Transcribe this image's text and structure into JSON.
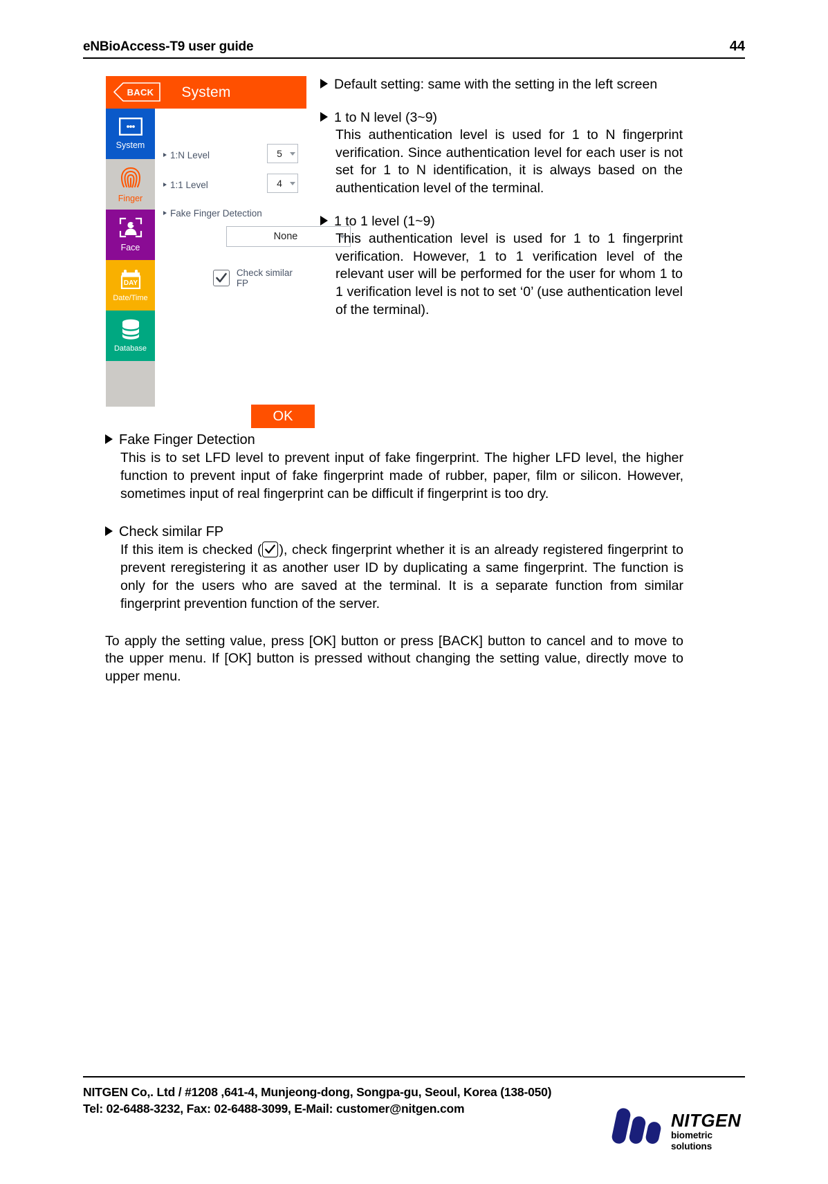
{
  "header": {
    "title": "eNBioAccess-T9 user guide",
    "page_number": "44"
  },
  "device": {
    "back_label": "BACK",
    "screen_title": "System",
    "sidebar": [
      {
        "label": "System",
        "icon": "system-window-icon",
        "color": "#0a59c9"
      },
      {
        "label": "Finger",
        "icon": "fingerprint-icon",
        "color": "#cccac6"
      },
      {
        "label": "Face",
        "icon": "face-enroll-icon",
        "color": "#8a0b94"
      },
      {
        "label": "Date/Time",
        "icon": "calendar-day-icon",
        "color": "#f9b000"
      },
      {
        "label": "Database",
        "icon": "database-stack-icon",
        "color": "#00a881"
      }
    ],
    "rows": [
      {
        "label": "1:N Level",
        "value": "5"
      },
      {
        "label": "1:1 Level",
        "value": "4"
      }
    ],
    "fake_finger": {
      "label": "Fake Finger Detection",
      "value": "None"
    },
    "check_similar": {
      "label": "Check similar FP",
      "checked": true
    },
    "ok_label": "OK"
  },
  "right_column": {
    "default_setting": "Default setting: same with the setting in the left screen",
    "sections": [
      {
        "heading": "1 to N level (3~9)",
        "body": "This authentication level is used for 1 to N fingerprint verification. Since authentication level for each user is not set for 1 to N identification, it is always based on the authentication level of the terminal."
      },
      {
        "heading": "1 to 1 level (1~9)",
        "body": "This authentication level is used for 1 to 1 fingerprint verification. However, 1 to 1 verification level of the relevant user will be performed for the user for whom 1 to 1 verification level is not to set ‘0’ (use authentication level of the terminal)."
      }
    ]
  },
  "lower_sections": [
    {
      "heading": "Fake Finger Detection",
      "body": "This is to set LFD level to prevent input of fake fingerprint. The higher LFD level, the higher function to prevent input of fake fingerprint made of rubber, paper, film or silicon. However, sometimes input of real fingerprint can be difficult if fingerprint is too dry."
    }
  ],
  "check_similar_section": {
    "heading": "Check similar FP",
    "body_before": "If this item is checked (",
    "body_after": "), check fingerprint whether it is an already registered fingerprint to prevent reregistering it as another user ID by duplicating a same fingerprint. The function is only for the users who are saved at the terminal. It is a separate function from similar fingerprint prevention function of the server."
  },
  "closing_paragraph": "To apply the setting value, press [OK] button or press [BACK] button to cancel and to move to the upper menu. If [OK] button is pressed without changing the setting value, directly move to upper menu.",
  "footer": {
    "line1": "NITGEN Co,. Ltd / #1208 ,641-4, Munjeong-dong, Songpa-gu, Seoul, Korea (138-050)",
    "line2": "Tel: 02-6488-3232, Fax: 02-6488-3099, E-Mail: customer@nitgen.com",
    "logo_name": "NITGEN",
    "logo_tagline": "biometric solutions",
    "logo_color": "#1a1f7a"
  }
}
